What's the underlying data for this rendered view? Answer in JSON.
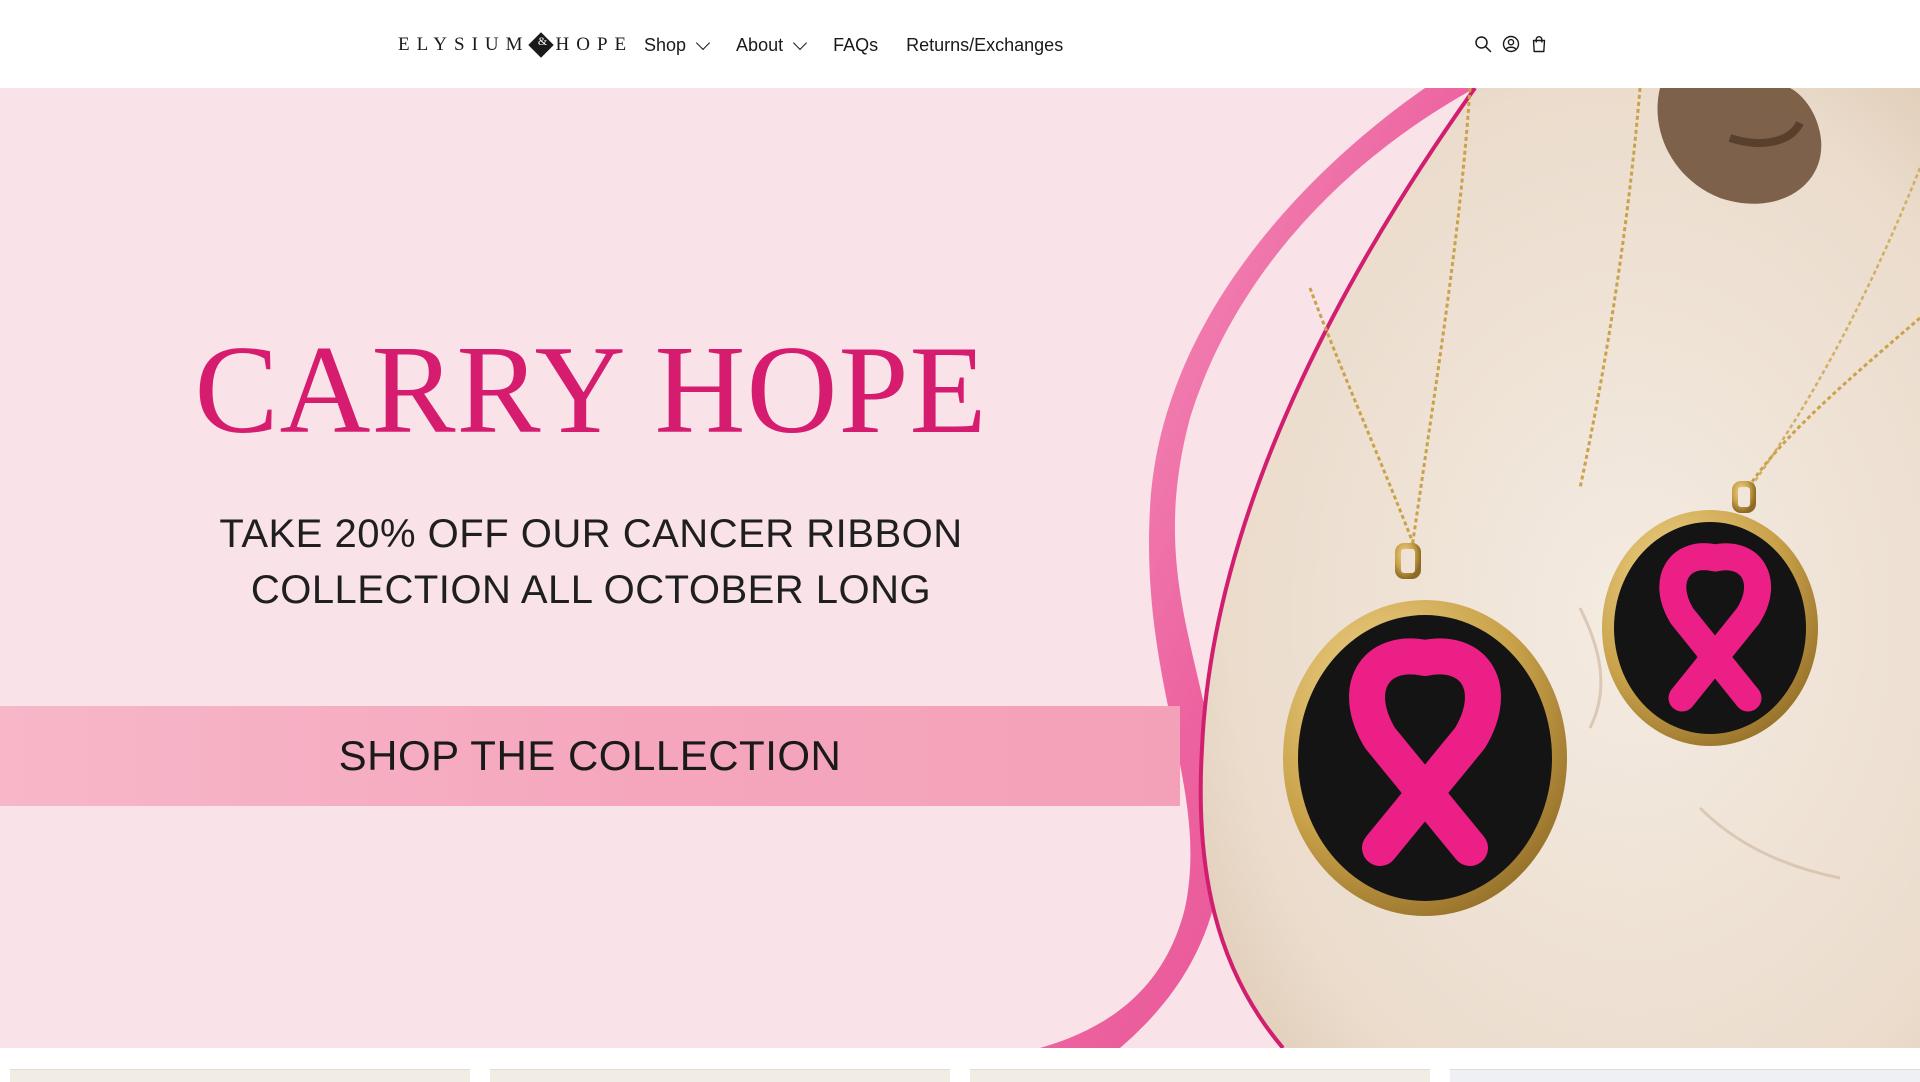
{
  "header": {
    "logo": {
      "left": "ELYSIUM",
      "right": "HOPE"
    },
    "nav": [
      {
        "label": "Shop",
        "has_dropdown": true
      },
      {
        "label": "About",
        "has_dropdown": true
      },
      {
        "label": "FAQs",
        "has_dropdown": false
      },
      {
        "label": "Returns/Exchanges",
        "has_dropdown": false
      }
    ],
    "icons": [
      "search-icon",
      "account-icon",
      "cart-icon"
    ]
  },
  "hero": {
    "title": "CARRY HOPE",
    "subtitle_line1": "TAKE 20% OFF OUR CANCER RIBBON",
    "subtitle_line2": "COLLECTION ALL OCTOBER LONG",
    "cta": "SHOP THE COLLECTION",
    "colors": {
      "background": "#f9e2e8",
      "title": "#d61c6f",
      "ribbon": "#ec4f94",
      "band": "#f5a6bd",
      "wood": "#efe3d8",
      "pendant_face": "#141414",
      "pendant_ribbon": "#ec1f86",
      "gold": "#c9a24a"
    }
  },
  "products_strip": {
    "visible_items": 4
  }
}
